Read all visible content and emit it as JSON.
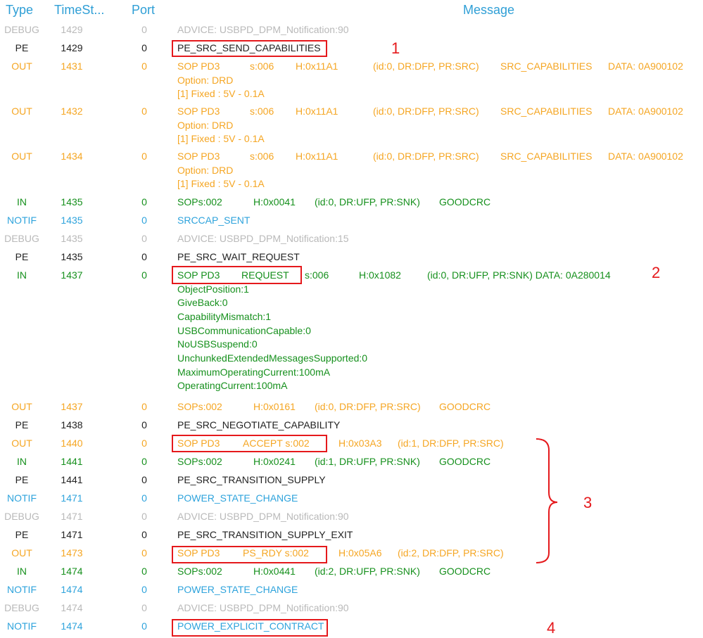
{
  "columns": {
    "type": "Type",
    "timestamp": "TimeSt...",
    "port": "Port",
    "message": "Message"
  },
  "rows": [
    {
      "type": "DEBUG",
      "ts": "1429",
      "port": "0",
      "msg": [
        "ADVICE: USBPD_DPM_Notification:90"
      ]
    },
    {
      "type": "PE",
      "ts": "1429",
      "port": "0",
      "msg": [
        "PE_SRC_SEND_CAPABILITIES"
      ]
    },
    {
      "type": "OUT",
      "ts": "1431",
      "port": "0",
      "msg": [
        "SOP PD3",
        "s:006",
        "H:0x11A1",
        "(id:0, DR:DFP, PR:SRC)",
        "SRC_CAPABILITIES",
        "DATA: 0A900102"
      ],
      "extra": [
        "Option:  DRD",
        "[1] Fixed : 5V - 0.1A"
      ]
    },
    {
      "type": "OUT",
      "ts": "1432",
      "port": "0",
      "msg": [
        "SOP PD3",
        "s:006",
        "H:0x11A1",
        "(id:0, DR:DFP, PR:SRC)",
        "SRC_CAPABILITIES",
        "DATA: 0A900102"
      ],
      "extra": [
        "Option:  DRD",
        "[1] Fixed : 5V - 0.1A"
      ]
    },
    {
      "type": "OUT",
      "ts": "1434",
      "port": "0",
      "msg": [
        "SOP PD3",
        "s:006",
        "H:0x11A1",
        "(id:0, DR:DFP, PR:SRC)",
        "SRC_CAPABILITIES",
        "DATA: 0A900102"
      ],
      "extra": [
        "Option:  DRD",
        "[1] Fixed : 5V - 0.1A"
      ]
    },
    {
      "type": "IN",
      "ts": "1435",
      "port": "0",
      "msg": [
        "SOPs:002",
        "H:0x0041",
        "(id:0, DR:UFP, PR:SNK)",
        "GOODCRC"
      ]
    },
    {
      "type": "NOTIF",
      "ts": "1435",
      "port": "0",
      "msg": [
        "SRCCAP_SENT"
      ]
    },
    {
      "type": "DEBUG",
      "ts": "1435",
      "port": "0",
      "msg": [
        "ADVICE: USBPD_DPM_Notification:15"
      ]
    },
    {
      "type": "PE",
      "ts": "1435",
      "port": "0",
      "msg": [
        "PE_SRC_WAIT_REQUEST"
      ]
    },
    {
      "type": "IN",
      "ts": "1437",
      "port": "0",
      "msg": [
        "SOP PD3",
        "REQUEST",
        "s:006",
        "H:0x1082",
        "(id:0, DR:UFP, PR:SNK)  DATA: 0A280014"
      ],
      "extra": [
        "ObjectPosition:1",
        "GiveBack:0",
        "CapabilityMismatch:1",
        "USBCommunicationCapable:0",
        "NoUSBSuspend:0",
        "UnchunkedExtendedMessagesSupported:0",
        "MaximumOperatingCurrent:100mA",
        "OperatingCurrent:100mA"
      ]
    },
    {
      "type": "OUT",
      "ts": "1437",
      "port": "0",
      "msg": [
        "SOPs:002",
        "H:0x0161",
        "(id:0, DR:DFP, PR:SRC)",
        "GOODCRC"
      ]
    },
    {
      "type": "PE",
      "ts": "1438",
      "port": "0",
      "msg": [
        "PE_SRC_NEGOTIATE_CAPABILITY"
      ]
    },
    {
      "type": "OUT",
      "ts": "1440",
      "port": "0",
      "msg": [
        "SOP PD3",
        "ACCEPT s:002",
        "H:0x03A3",
        "(id:1, DR:DFP, PR:SRC)"
      ]
    },
    {
      "type": "IN",
      "ts": "1441",
      "port": "0",
      "msg": [
        "SOPs:002",
        "H:0x0241",
        "(id:1, DR:UFP, PR:SNK)",
        "GOODCRC"
      ]
    },
    {
      "type": "PE",
      "ts": "1441",
      "port": "0",
      "msg": [
        "PE_SRC_TRANSITION_SUPPLY"
      ]
    },
    {
      "type": "NOTIF",
      "ts": "1471",
      "port": "0",
      "msg": [
        "POWER_STATE_CHANGE"
      ]
    },
    {
      "type": "DEBUG",
      "ts": "1471",
      "port": "0",
      "msg": [
        "ADVICE: USBPD_DPM_Notification:90"
      ]
    },
    {
      "type": "PE",
      "ts": "1471",
      "port": "0",
      "msg": [
        "PE_SRC_TRANSITION_SUPPLY_EXIT"
      ]
    },
    {
      "type": "OUT",
      "ts": "1473",
      "port": "0",
      "msg": [
        "SOP PD3",
        "PS_RDY  s:002",
        "H:0x05A6",
        "(id:2, DR:DFP, PR:SRC)"
      ]
    },
    {
      "type": "IN",
      "ts": "1474",
      "port": "0",
      "msg": [
        "SOPs:002",
        "H:0x0441",
        "(id:2, DR:UFP, PR:SNK)",
        "GOODCRC"
      ]
    },
    {
      "type": "NOTIF",
      "ts": "1474",
      "port": "0",
      "msg": [
        "POWER_STATE_CHANGE"
      ]
    },
    {
      "type": "DEBUG",
      "ts": "1474",
      "port": "0",
      "msg": [
        "ADVICE: USBPD_DPM_Notification:90"
      ]
    },
    {
      "type": "NOTIF",
      "ts": "1474",
      "port": "0",
      "msg": [
        "POWER_EXPLICIT_CONTRACT"
      ]
    }
  ],
  "annotations": {
    "n1": "1",
    "n2": "2",
    "n3": "3",
    "n4": "4"
  },
  "colors": {
    "DEBUG": "#b9b9b9",
    "PE": "#222222",
    "OUT": "#f5a623",
    "IN": "#16901d",
    "NOTIF": "#2ea3dc",
    "highlight": "#e5191c"
  }
}
